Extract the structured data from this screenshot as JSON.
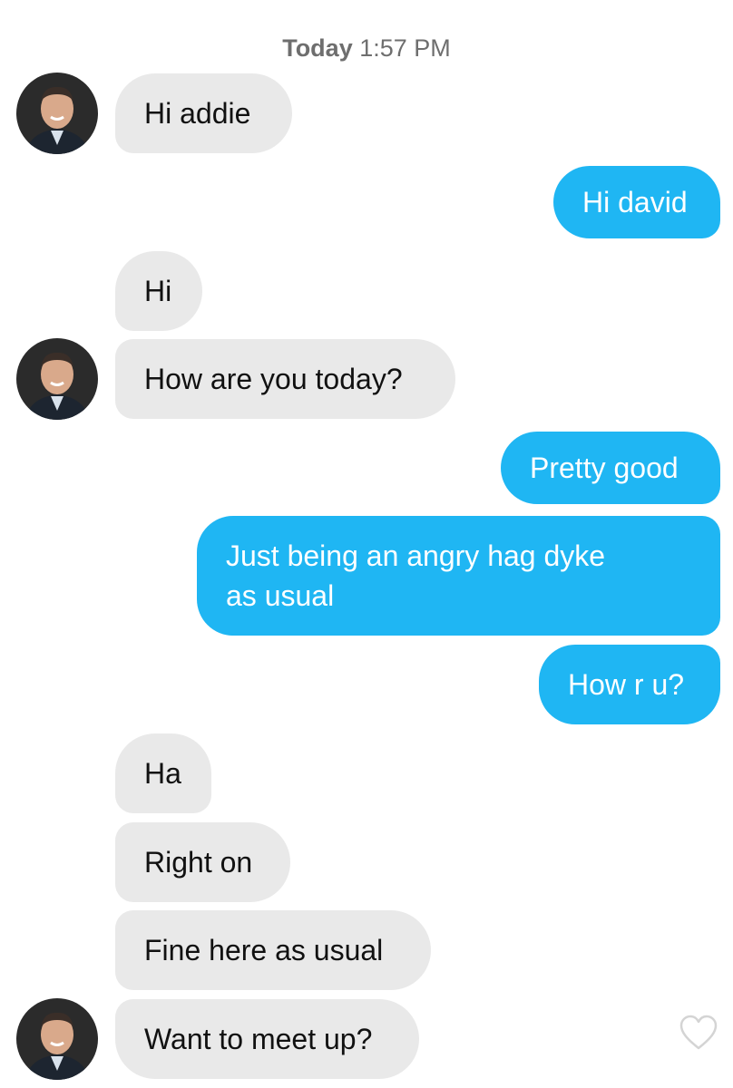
{
  "header": {
    "timestamp_day": "Today",
    "timestamp_time": "1:57 PM"
  },
  "messages": {
    "m1": "Hi addie",
    "m2": "Hi david",
    "m3": "Hi",
    "m4": "How are you today?",
    "m5": "Pretty good",
    "m6_line1": "Just being an angry hag dyke",
    "m6_line2": "as usual",
    "m7": "How r u?",
    "m8": "Ha",
    "m9": "Right on",
    "m10": "Fine here as usual",
    "m11": "Want to meet up?"
  },
  "icons": {
    "avatar": "profile-photo",
    "like": "heart-icon"
  },
  "colors": {
    "sent_bubble": "#1fb6f3",
    "received_bubble": "#e9e9e9",
    "sent_text": "#ffffff",
    "received_text": "#111111"
  }
}
